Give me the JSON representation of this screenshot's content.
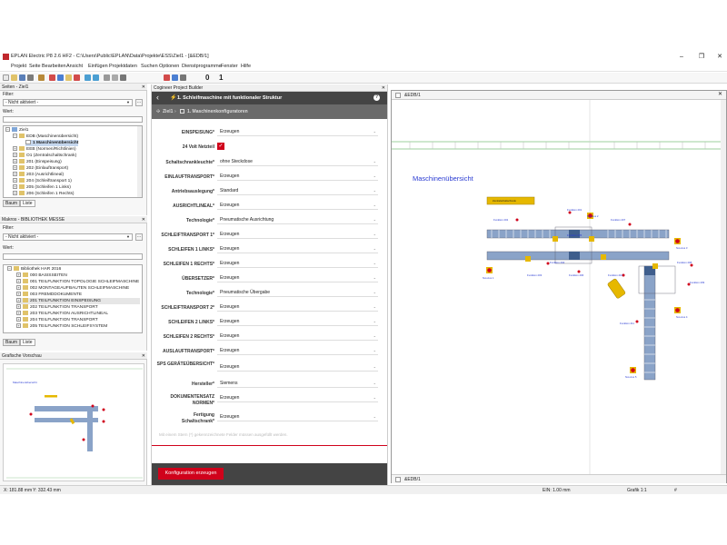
{
  "window": {
    "title": "EPLAN Electric P8 2.6 HF2 - C:\\Users\\Public\\EPLAN\\Data\\Projekte\\ESS\\Ziel1 - [&EDB/1]",
    "controls": [
      "–",
      "❐",
      "✕"
    ]
  },
  "menu": [
    "Projekt",
    "Seite",
    "Bearbeiten",
    "Ansicht",
    "Einfügen",
    "Projektdaten",
    "Suchen",
    "Optionen",
    "Dienstprogramme",
    "Fenster",
    "Hilfe"
  ],
  "toolbar": {
    "num1": "0",
    "num2": "1"
  },
  "pages_panel": {
    "title": "Seiten - Ziel1",
    "filter_label": "Filter:",
    "filter_value": "- Nicht aktiviert -",
    "value_label": "Wert:",
    "tree": [
      "Ziel1",
      "EDB (Maschinenübersicht)",
      "1 Maschinenübersicht",
      "EEB (Normen/Richtlinien)",
      "O1 (Zentralschaltschrank)",
      "201 (Einspeisung)",
      "202 (Einlauftransport)",
      "203 (Ausrichtlineal)",
      "204 (Schleiftransport 1)",
      "205 (Schleifen 1 Links)",
      "206 (Schleifen 1 Rechts)"
    ],
    "tabs": [
      "Baum",
      "Liste"
    ]
  },
  "macros_panel": {
    "title": "Makros - BIBLIOTHEK MESSE",
    "filter_label": "Filter:",
    "filter_value": "- Nicht aktiviert -",
    "value_label": "Wert:",
    "tree": [
      "Bibliothek HAR 2016",
      "000 BASISSEITEN",
      "001 TEILFUNKTION TOPOLOGIE SCHLEIFMASCHINE",
      "002 MONTAGEAUFBAUTEN SCHLEIFMASCHINE",
      "003 FREMDDOKUMENTE",
      "201 TEILFUNKTION EINSPEISUNG",
      "202 TEILFUNKTION TRANSPORT",
      "203 TEILFUNKTION AUSRICHTLINEAL",
      "204 TEILFUNKTION TRANSPORT",
      "205 TEILFUNKTION SCHLEIFSYSTEM"
    ],
    "tabs": [
      "Baum",
      "Liste"
    ]
  },
  "preview_panel": {
    "title": "Grafische Vorschau",
    "page_title": "Maschinenübersicht"
  },
  "builder": {
    "window_title": "Cogineer Project Builder",
    "header": "1. Schleifmaschine mit funktionaler Struktur",
    "help": "?",
    "back": "‹",
    "breadcrumb_root": "Ziel1",
    "breadcrumb_sep": "›",
    "breadcrumb_page": "1. Maschinenkonfiguratoren",
    "fields": [
      {
        "label": "EINSPEISUNG*",
        "value": "Erzeugen"
      },
      {
        "label": "24 Volt Netzteil",
        "value": "✓"
      },
      {
        "label": "Schaltschrankleuchte*",
        "value": "ohne Steckdose"
      },
      {
        "label": "EINLAUFTRANSPORT*",
        "value": "Erzeugen"
      },
      {
        "label": "Antriebsauslegung*",
        "value": "Standard"
      },
      {
        "label": "AUSRICHTLINEAL*",
        "value": "Erzeugen"
      },
      {
        "label": "Technologie*",
        "value": "Pneumatische Ausrichtung"
      },
      {
        "label": "SCHLEIFTRANSPORT 1*",
        "value": "Erzeugen"
      },
      {
        "label": "SCHLEIFEN 1 LINKS*",
        "value": "Erzeugen"
      },
      {
        "label": "SCHLEIFEN 1 RECHTS*",
        "value": "Erzeugen"
      },
      {
        "label": "ÜBERSETZER*",
        "value": "Erzeugen"
      },
      {
        "label": "Technologie*",
        "value": "Pneumatische Übergabe"
      },
      {
        "label": "SCHLEIFTRANSPORT 2*",
        "value": "Erzeugen"
      },
      {
        "label": "SCHLEIFEN 2 LINKS*",
        "value": "Erzeugen"
      },
      {
        "label": "SCHLEIFEN 2 RECHTS*",
        "value": "Erzeugen"
      },
      {
        "label": "AUSLAUFTRANSPORT*",
        "value": "Erzeugen"
      },
      {
        "label": "SPS GERÄTEÜBERSICHT*",
        "value": "Erzeugen"
      },
      {
        "label": "Hersteller*",
        "value": "Siemens"
      },
      {
        "label": "DOKUMENTENSATZ NORMEN*",
        "value": "Erzeugen"
      },
      {
        "label": "Fertigung Schaltschrank*",
        "value": "Erzeugen"
      }
    ],
    "hint": "Mit einem Stern (*) gekennzeichnete Felder müssen ausgefüllt werden.",
    "button": "Konfiguration erzeugen"
  },
  "canvas": {
    "tab_top": "&EDB/1",
    "tab_bottom": "&EDB/1",
    "heading": "Maschinenübersicht",
    "labels": {
      "schaltschrank": "Zentralschaltschrank",
      "f201": "Funktion 201",
      "f202": "Funktion 202",
      "f203": "Funktion 203",
      "f204": "Funktion 204",
      "f205": "Funktion 205",
      "f206": "Funktion 206",
      "f207": "Funktion 207",
      "f208": "Funktion 208",
      "f209": "Funktion 209",
      "f210": "Funktion 210",
      "f211": "Funktion 211",
      "na1": "Not-Aus 1",
      "na2": "Not-Aus 2",
      "na3": "Not-Aus 3",
      "na4": "Not-Aus 4",
      "na5": "Not-Aus 5"
    }
  },
  "status": {
    "x": "X: 181.88 mm",
    "y": "Y: 332.43 mm",
    "ein": "EIN: 1.00 mm",
    "grafik": "Grafik 1:1",
    "hash": "#"
  },
  "colors": {
    "accent_red": "#d0021b",
    "dark_header": "#444444",
    "conveyor_blue": "#8aa3c8",
    "yellow": "#e6b800"
  }
}
